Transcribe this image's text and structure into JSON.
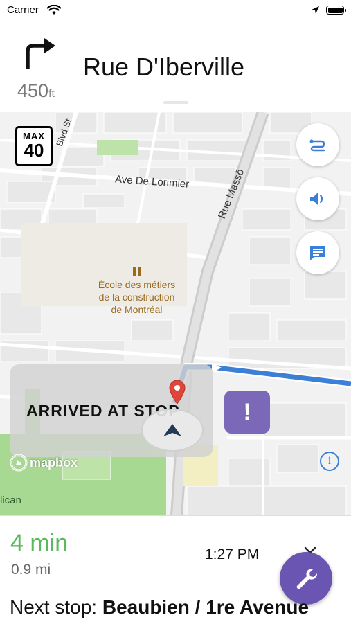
{
  "status_bar": {
    "carrier": "Carrier"
  },
  "instruction": {
    "street": "Rue D'Iberville",
    "distance_value": "450",
    "distance_unit": "ft"
  },
  "map": {
    "speed_limit": {
      "label": "MAX",
      "value": "40"
    },
    "street_labels": {
      "lorimier": "Ave De Lorimier",
      "masson": "Rue Massõ",
      "blvd": "Blvd St"
    },
    "poi": {
      "line1": "École des métiers",
      "line2": "de la construction",
      "line3": "de Montréal"
    },
    "arrived_text": "ARRIVED AT STOP",
    "alert_symbol": "!",
    "attribution": "mapbox",
    "info_symbol": "i",
    "partial_label": "lican",
    "buttons": [
      "route-overview-icon",
      "volume-icon",
      "chat-icon"
    ],
    "route_color": "#3b7fd6"
  },
  "eta": {
    "minutes": "4 min",
    "distance": "0.9 mi",
    "arrival_time": "1:27 PM"
  },
  "next_stop": {
    "prefix": "Next stop: ",
    "name": "Beaubien / 1re Avenue"
  },
  "colors": {
    "accent_purple": "#6a55b3",
    "eta_green": "#5cb85c",
    "route_blue": "#3b7fd6"
  }
}
